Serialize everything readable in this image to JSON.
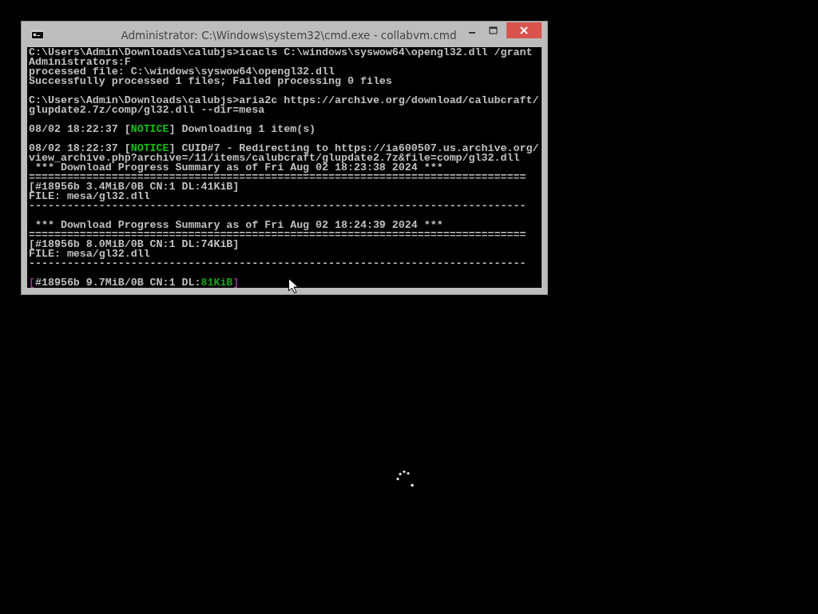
{
  "window": {
    "title": "Administrator: C:\\Windows\\system32\\cmd.exe - collabvm.cmd"
  },
  "console": {
    "blocks": [
      [
        [
          {
            "text": "C:\\Users\\Admin\\Downloads\\calubjs>icacls C:\\windows\\syswow64\\opengl32.dll /grant",
            "color": "#c0c0c0"
          }
        ],
        [
          {
            "text": "Administrators:F",
            "color": "#c0c0c0"
          }
        ],
        [
          {
            "text": "processed file: C:\\windows\\syswow64\\opengl32.dll",
            "color": "#c0c0c0"
          }
        ],
        [
          {
            "text": "Successfully processed 1 files; Failed processing 0 files",
            "color": "#c0c0c0"
          }
        ]
      ],
      [
        [
          {
            "text": "C:\\Users\\Admin\\Downloads\\calubjs>aria2c https://archive.org/download/calubcraft/",
            "color": "#c0c0c0"
          }
        ],
        [
          {
            "text": "glupdate2.7z/comp/gl32.dll --dir=mesa",
            "color": "#c0c0c0"
          }
        ]
      ],
      [
        [
          {
            "text": "08/02 18:22:37 [",
            "color": "#c0c0c0"
          },
          {
            "text": "NOTICE",
            "color": "#13c313"
          },
          {
            "text": "] Downloading 1 item(s)",
            "color": "#c0c0c0"
          }
        ]
      ],
      [
        [
          {
            "text": "08/02 18:22:37 [",
            "color": "#c0c0c0"
          },
          {
            "text": "NOTICE",
            "color": "#13c313"
          },
          {
            "text": "] CUID#7 - Redirecting to https://ia600507.us.archive.org/",
            "color": "#c0c0c0"
          }
        ],
        [
          {
            "text": "view_archive.php?archive=/11/items/calubcraft/glupdate2.7z&file=comp/gl32.dll",
            "color": "#c0c0c0"
          }
        ],
        [
          {
            "text": " *** Download Progress Summary as of Fri Aug 02 18:23:38 2024 ***",
            "color": "#c0c0c0"
          }
        ],
        [
          {
            "text": "==============================================================================",
            "color": "#c0c0c0"
          }
        ],
        [
          {
            "text": "[#18956b 3.4MiB/0B CN:1 DL:41KiB]",
            "color": "#c0c0c0"
          }
        ],
        [
          {
            "text": "FILE: mesa/gl32.dll",
            "color": "#c0c0c0"
          }
        ],
        [
          {
            "text": "------------------------------------------------------------------------------",
            "color": "#c0c0c0"
          }
        ]
      ],
      [
        [
          {
            "text": " *** Download Progress Summary as of Fri Aug 02 18:24:39 2024 ***",
            "color": "#c0c0c0"
          }
        ],
        [
          {
            "text": "==============================================================================",
            "color": "#c0c0c0"
          }
        ],
        [
          {
            "text": "[#18956b 8.0MiB/0B CN:1 DL:74KiB]",
            "color": "#c0c0c0"
          }
        ],
        [
          {
            "text": "FILE: mesa/gl32.dll",
            "color": "#c0c0c0"
          }
        ],
        [
          {
            "text": "------------------------------------------------------------------------------",
            "color": "#c0c0c0"
          }
        ]
      ],
      [
        [
          {
            "text": "[",
            "color": "#8a3a8a"
          },
          {
            "text": "#18956b 9.7MiB/0B CN:1 DL:",
            "color": "#c0c0c0"
          },
          {
            "text": "81KiB",
            "color": "#13a313"
          },
          {
            "text": "]",
            "color": "#8a3a8a"
          }
        ]
      ]
    ]
  }
}
